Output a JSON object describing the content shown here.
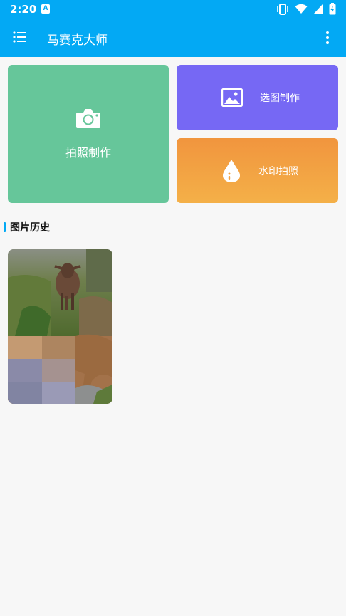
{
  "status_bar": {
    "time": "2:20",
    "badge": "A",
    "icons": [
      "vibrate-icon",
      "wifi-icon",
      "signal-icon",
      "battery-icon"
    ]
  },
  "app_bar": {
    "title": "马赛克大师",
    "menu_icon": "menu-list-icon",
    "more_icon": "more-vertical-icon"
  },
  "tiles": {
    "photo": {
      "label": "拍照制作",
      "icon": "camera-icon",
      "color": "#66c69a"
    },
    "pick": {
      "label": "选图制作",
      "icon": "image-icon",
      "color": "#7668f4"
    },
    "watermark": {
      "label": "水印拍照",
      "icon": "water-drop-icon",
      "color": "#f3a243"
    }
  },
  "history": {
    "title": "图片历史",
    "items": [
      {
        "type": "photo",
        "subject": "cow in field, partially mosaicked"
      }
    ]
  },
  "colors": {
    "primary": "#03a9f4",
    "background": "#f7f7f7"
  }
}
